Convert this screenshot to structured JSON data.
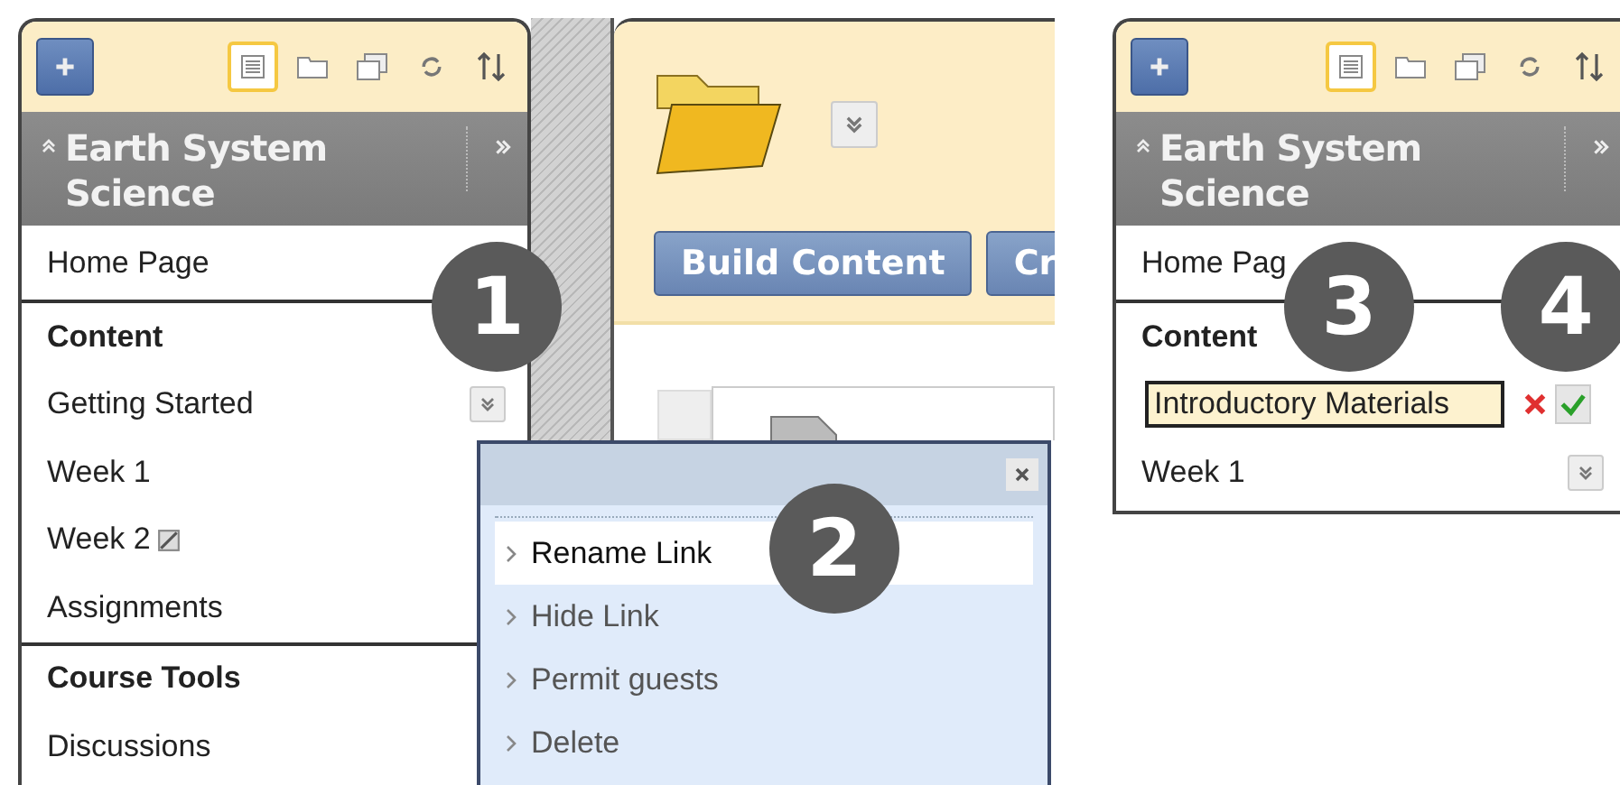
{
  "left_panel": {
    "toolbar": [
      {
        "kind": "list",
        "selected": true
      },
      {
        "kind": "folder",
        "selected": false
      },
      {
        "kind": "windows",
        "selected": false
      },
      {
        "kind": "refresh",
        "selected": false
      },
      {
        "kind": "sort",
        "selected": false
      }
    ],
    "title": "Earth System Science",
    "items": [
      {
        "kind": "link",
        "label": "Home Page"
      },
      {
        "kind": "header",
        "label": "Content"
      },
      {
        "kind": "link",
        "label": "Getting Started",
        "menu": true
      },
      {
        "kind": "link",
        "label": "Week 1"
      },
      {
        "kind": "link",
        "label": "Week 2",
        "hidden": true
      },
      {
        "kind": "link",
        "label": "Assignments"
      },
      {
        "kind": "header",
        "label": "Course Tools"
      },
      {
        "kind": "link",
        "label": "Discussions"
      }
    ]
  },
  "content_area": {
    "buttons": [
      "Build Content",
      "Cr"
    ]
  },
  "link_menu": {
    "items": [
      {
        "label": "Rename Link",
        "selected": true
      },
      {
        "label": "Hide Link",
        "selected": false
      },
      {
        "label": "Permit guests",
        "selected": false
      },
      {
        "label": "Delete",
        "selected": false
      }
    ]
  },
  "right_panel": {
    "toolbar": [
      {
        "kind": "list",
        "selected": true
      },
      {
        "kind": "folder",
        "selected": false
      },
      {
        "kind": "windows",
        "selected": false
      },
      {
        "kind": "refresh",
        "selected": false
      },
      {
        "kind": "sort",
        "selected": false
      }
    ],
    "title": "Earth System Science",
    "items": [
      {
        "kind": "link",
        "label": "Home Pag"
      },
      {
        "kind": "header",
        "label": "Content"
      },
      {
        "kind": "edit",
        "value": "Introductory Materials"
      },
      {
        "kind": "link",
        "label": "Week 1",
        "menu": true
      }
    ]
  },
  "step_badges": [
    "1",
    "2",
    "3",
    "4"
  ]
}
